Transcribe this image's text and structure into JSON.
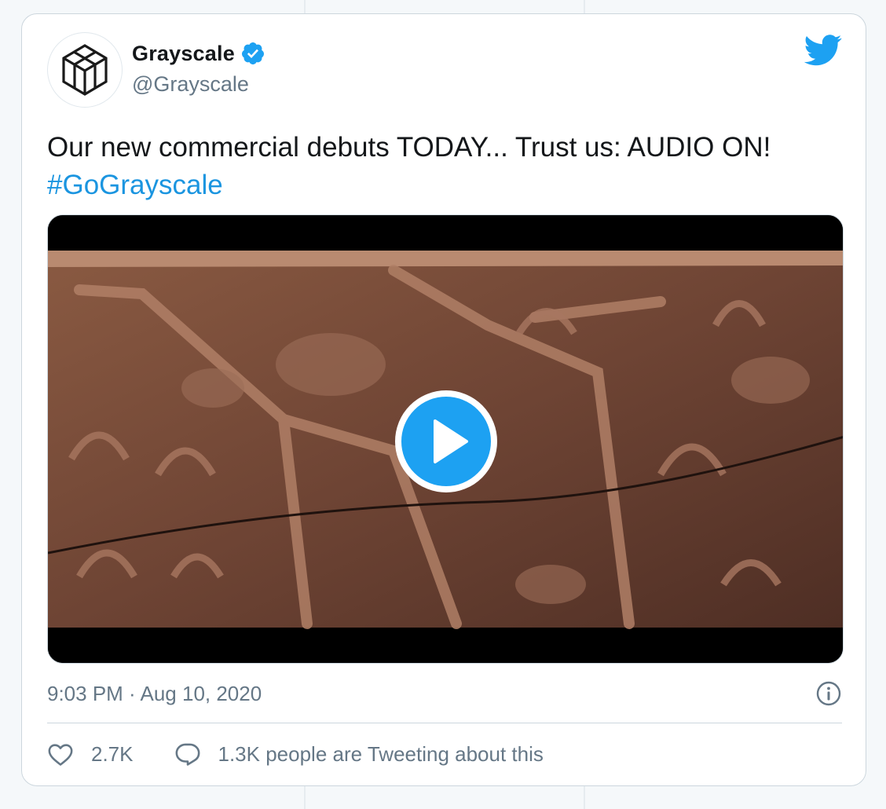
{
  "author": {
    "display_name": "Grayscale",
    "handle": "@Grayscale",
    "verified": true
  },
  "tweet": {
    "text": "Our new commercial debuts TODAY... Trust us: AUDIO ON!",
    "hashtag": "#GoGrayscale",
    "timestamp": "9:03 PM · Aug 10, 2020"
  },
  "media": {
    "type": "video",
    "play_icon": "play-icon"
  },
  "stats": {
    "likes": "2.7K",
    "conversation": "1.3K people are Tweeting about this"
  },
  "icons": {
    "brand": "twitter-bird-icon",
    "verified": "verified-badge-icon",
    "info": "info-icon",
    "like": "heart-icon",
    "reply": "speech-bubble-icon"
  },
  "colors": {
    "accent": "#1da1f2",
    "link": "#1b95e0",
    "muted": "#657786",
    "border": "#ccd6dd"
  }
}
